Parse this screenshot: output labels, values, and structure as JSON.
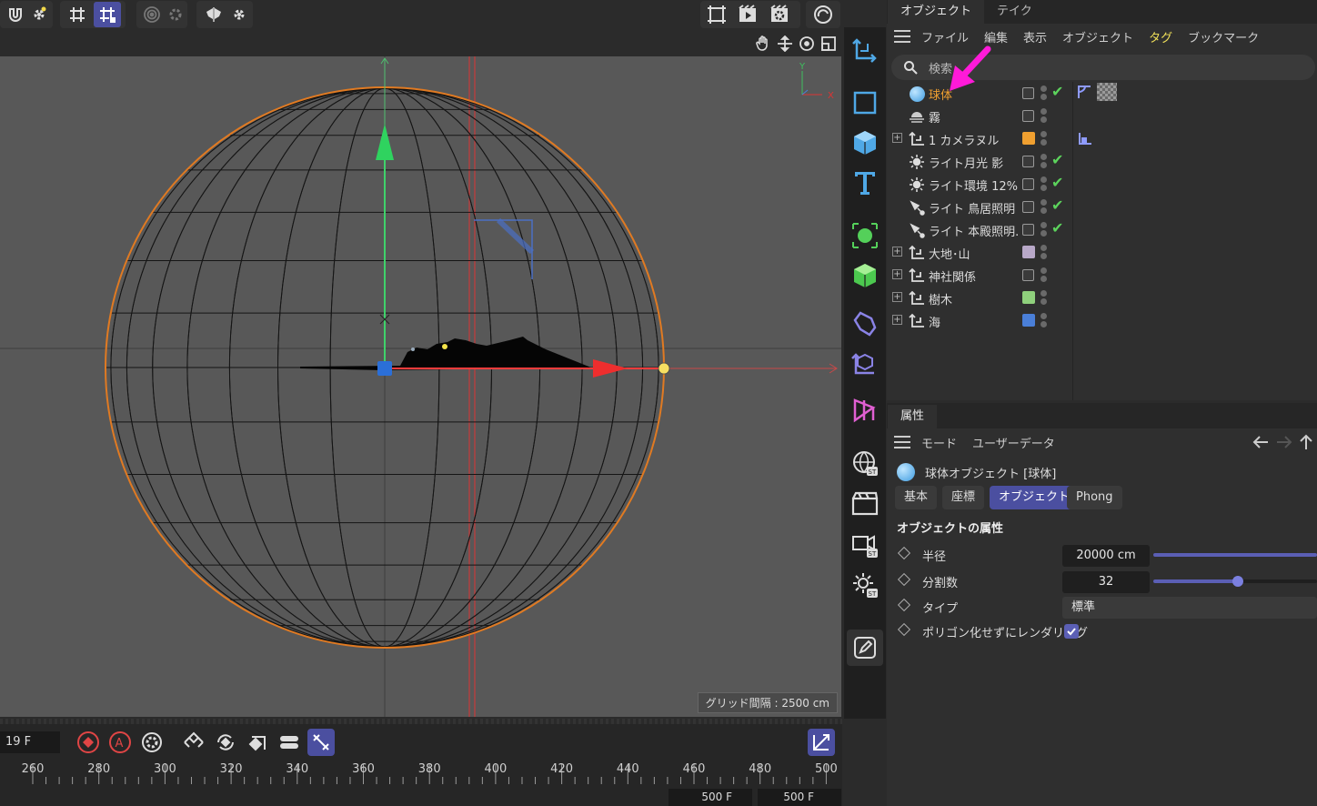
{
  "viewport": {
    "hud_grid": "グリッド間隔 : 2500 cm",
    "axis_y": "Y",
    "axis_x": "X"
  },
  "object_manager": {
    "tabs": [
      "オブジェクト",
      "テイク"
    ],
    "menu": [
      "ファイル",
      "編集",
      "表示",
      "オブジェクト",
      "タグ",
      "ブックマーク"
    ],
    "search_placeholder": "検索",
    "rows": [
      {
        "name": "球体",
        "icon": "sphere-icon",
        "selected": true,
        "check": true,
        "color": null
      },
      {
        "name": "霧",
        "icon": "fog-icon",
        "check": false,
        "color": null
      },
      {
        "name": "1 カメラヌル",
        "icon": "null-icon",
        "expandable": true,
        "color": "#f0a030"
      },
      {
        "name": "ライト月光 影",
        "icon": "light-icon",
        "check": true
      },
      {
        "name": "ライト環境 12%",
        "icon": "light-icon",
        "check": true
      },
      {
        "name": "ライト 鳥居照明",
        "icon": "spotlight-icon",
        "check": true
      },
      {
        "name": "ライト 本殿照明.",
        "icon": "spotlight-icon",
        "check": true
      },
      {
        "name": "大地･山",
        "icon": "null-icon",
        "expandable": true,
        "color": "#b8a8c8"
      },
      {
        "name": "神社関係",
        "icon": "null-icon",
        "expandable": true,
        "color": null
      },
      {
        "name": "樹木",
        "icon": "null-icon",
        "expandable": true,
        "color": "#8fd07c"
      },
      {
        "name": "海",
        "icon": "null-icon",
        "expandable": true,
        "color": "#4a7fd8"
      }
    ]
  },
  "attributes": {
    "tab": "属性",
    "menu": [
      "モード",
      "ユーザーデータ"
    ],
    "object_title": "球体オブジェクト [球体]",
    "tabs": [
      "基本",
      "座標",
      "オブジェクト",
      "Phong"
    ],
    "active_tab": "オブジェクト",
    "section": "オブジェクトの属性",
    "fields": {
      "radius_label": "半径",
      "radius_value": "20000 cm",
      "radius_slider": 1.0,
      "segments_label": "分割数",
      "segments_value": "32",
      "segments_slider": 0.52,
      "type_label": "タイプ",
      "type_value": "標準",
      "render_perfect_label": "ポリゴン化せずにレンダリング",
      "render_perfect_checked": true
    }
  },
  "timeline": {
    "current_frame": "19 F",
    "ruler_labels": [
      "260",
      "280",
      "300",
      "320",
      "340",
      "360",
      "380",
      "400",
      "420",
      "440",
      "460",
      "480",
      "500"
    ],
    "end_frame_a": "500 F",
    "end_frame_b": "500 F"
  },
  "colors": {
    "accent": "#4b4fa0",
    "selection_orange": "#f0a030",
    "annotation_arrow": "#ff1ad9"
  }
}
